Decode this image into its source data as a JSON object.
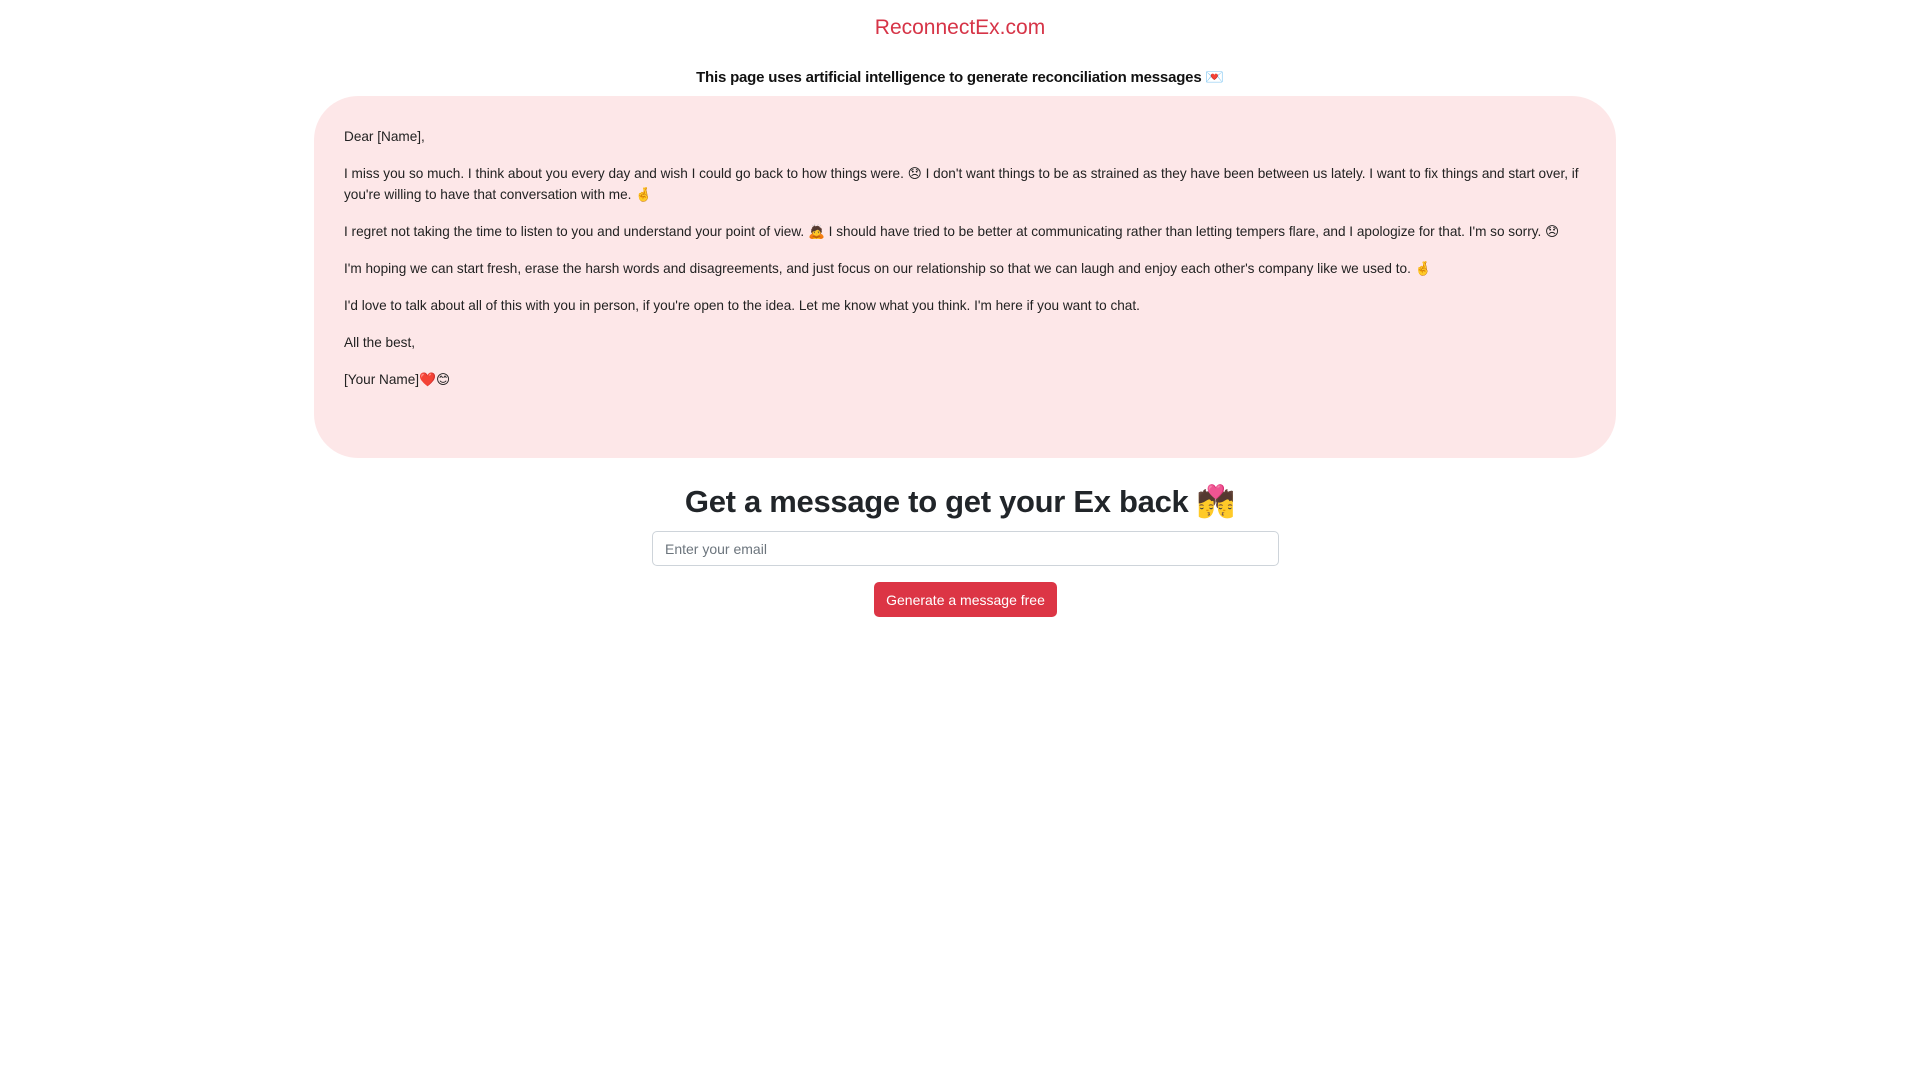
{
  "header": {
    "site_title": "ReconnectEx.com",
    "tagline": "This page uses artificial intelligence to generate reconciliation messages 💌"
  },
  "message": {
    "greeting": "Dear [Name],",
    "paragraphs": [
      "I miss you so much. I think about you every day and wish I could go back to how things were. 😞 I don't want things to be as strained as they have been between us lately. I want to fix things and start over, if you're willing to have that conversation with me. 🤞",
      "I regret not taking the time to listen to you and understand your point of view. 🙇 I should have tried to be better at communicating rather than letting tempers flare, and I apologize for that. I'm so sorry. 😞",
      "I'm hoping we can start fresh, erase the harsh words and disagreements, and just focus on our relationship so that we can laugh and enjoy each other's company like we used to. 🤞",
      "I'd love to talk about all of this with you in person, if you're open to the idea. Let me know what you think. I'm here if you want to chat."
    ],
    "closing": "All the best,",
    "signature": "[Your Name]❤️😊"
  },
  "cta": {
    "heading": "Get a message to get your Ex back 💏",
    "email_placeholder": "Enter your email",
    "email_value": "",
    "button_label": "Generate a message free"
  },
  "colors": {
    "accent": "#dc3545",
    "title": "#d63447",
    "card_background": "#fde7e8"
  }
}
